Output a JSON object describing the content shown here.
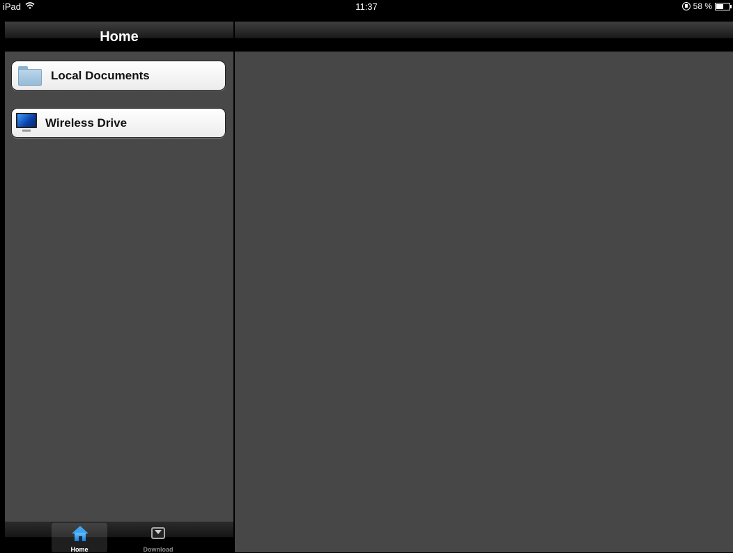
{
  "statusbar": {
    "device": "iPad",
    "time": "11:37",
    "battery_text": "58 %",
    "battery_level": 0.58
  },
  "master": {
    "title": "Home",
    "items": [
      {
        "label": "Local Documents",
        "icon": "folder-icon"
      },
      {
        "label": "Wireless Drive",
        "icon": "monitor-icon"
      }
    ]
  },
  "tabbar": {
    "tabs": [
      {
        "label": "Home",
        "icon": "home-icon",
        "selected": true
      },
      {
        "label": "Download",
        "icon": "download-icon",
        "selected": false
      }
    ]
  },
  "colors": {
    "pane_background": "#484848",
    "tab_selected_label": "#ffffff",
    "tab_label": "#8a8a8a"
  }
}
